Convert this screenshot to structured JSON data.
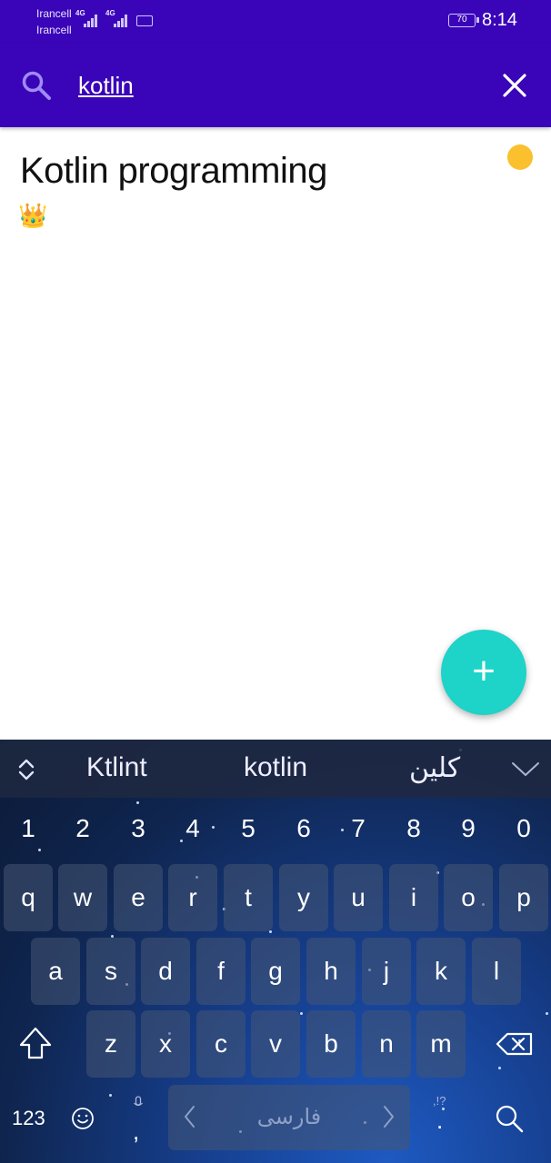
{
  "status_bar": {
    "carrier_1": "Irancell",
    "carrier_2": "Irancell",
    "network_1": "4G",
    "network_2": "4G",
    "battery_level": "70",
    "time": "8:14"
  },
  "search": {
    "query": "kotlin",
    "icon": "search-icon",
    "clear_icon": "close-icon"
  },
  "results": [
    {
      "title": "Kotlin programming",
      "emoji": "👑",
      "color_dot": "#fbc02d"
    }
  ],
  "fab": {
    "icon": "plus-icon",
    "label": "+"
  },
  "keyboard": {
    "suggestions": [
      "Ktlint",
      "kotlin",
      "کلین"
    ],
    "number_row": [
      "1",
      "2",
      "3",
      "4",
      "5",
      "6",
      "7",
      "8",
      "9",
      "0"
    ],
    "row_1": [
      "q",
      "w",
      "e",
      "r",
      "t",
      "y",
      "u",
      "i",
      "o",
      "p"
    ],
    "row_2": [
      "a",
      "s",
      "d",
      "f",
      "g",
      "h",
      "j",
      "k",
      "l"
    ],
    "row_3": [
      "z",
      "x",
      "c",
      "v",
      "b",
      "n",
      "m"
    ],
    "numbers_key": "123",
    "comma_key": ",",
    "space_label": "فارسی",
    "period_key": ".",
    "punct_hint": ",!?",
    "accent_color": "#3a05b8"
  }
}
